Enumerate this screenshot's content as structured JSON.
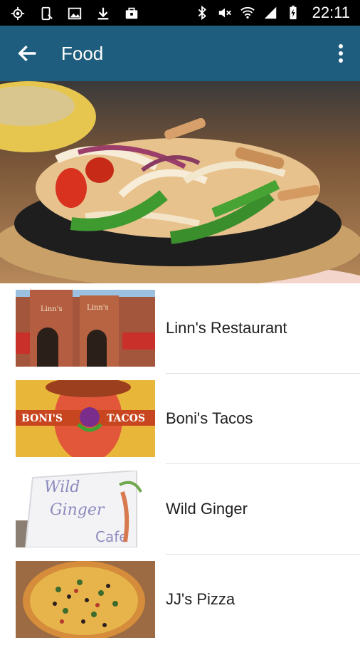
{
  "status_bar": {
    "time": "22:11",
    "left_icons": [
      "gps-icon",
      "phone-vibrate-icon",
      "image-icon",
      "download-icon",
      "briefcase-icon"
    ],
    "right_icons": [
      "bluetooth-icon",
      "mute-icon",
      "wifi-icon",
      "signal-icon",
      "battery-icon"
    ]
  },
  "app_bar": {
    "title": "Food",
    "back_icon": "arrow-back-icon",
    "menu_icon": "more-vert-icon",
    "color": "#1e5d7d"
  },
  "hero": {
    "description_icon": "fajitas-photo"
  },
  "list": {
    "items": [
      {
        "label": "Linn's Restaurant",
        "thumb": "restaurant-building-photo"
      },
      {
        "label": "Boni's Tacos",
        "thumb": "tacos-logo",
        "logo_left": "BONI'S",
        "logo_right": "TACOS"
      },
      {
        "label": "Wild Ginger",
        "thumb": "wild-ginger-sign-photo",
        "sign_text": [
          "Wild",
          "Ginger",
          "Cafe"
        ]
      },
      {
        "label": "JJ's Pizza",
        "thumb": "pizza-photo"
      }
    ]
  }
}
